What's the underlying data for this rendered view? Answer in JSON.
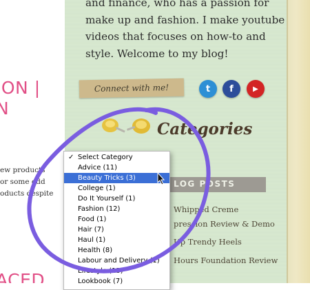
{
  "left_column": {
    "title_lines": [
      "ION |",
      "N"
    ],
    "snippet_lines": [
      "ew products",
      "or some odd",
      "oducts despite"
    ],
    "bottom_title": "ACED"
  },
  "about": {
    "lines": [
      "and finance, who has a passion for",
      "make up and fashion. I make youtube",
      "videos that focuses on how-to and",
      "style. Welcome to my blog!"
    ]
  },
  "connect": {
    "label": "Connect with me!"
  },
  "social": [
    {
      "icon": "twitter-icon",
      "glyph": "t",
      "color": "#2d8fd5"
    },
    {
      "icon": "facebook-icon",
      "glyph": "f",
      "color": "#2d4d9a"
    },
    {
      "icon": "youtube-icon",
      "glyph": "▶",
      "color": "#d32525"
    }
  ],
  "categories": {
    "title": "Categories",
    "options": [
      {
        "label": "Select Category",
        "checked": true
      },
      {
        "label": "Advice  (11)"
      },
      {
        "label": "Beauty Tricks  (3)",
        "selected": true
      },
      {
        "label": "College  (1)"
      },
      {
        "label": "Do It Yourself  (1)"
      },
      {
        "label": "Fashion  (12)"
      },
      {
        "label": "Food  (1)"
      },
      {
        "label": "Hair  (7)"
      },
      {
        "label": "Haul  (1)"
      },
      {
        "label": "Health  (8)"
      },
      {
        "label": "Labour and Delivery  (1)"
      },
      {
        "label": "Lifestyle  (15)"
      },
      {
        "label": "Lookbook  (7)"
      }
    ]
  },
  "recent_posts": {
    "header": "LOG POSTS",
    "items": [
      "Whipped Creme",
      "pression Review & Demo",
      "Up Trendy Heels",
      "Hours Foundation Review"
    ]
  },
  "colors": {
    "accent_pink": "#e14f86",
    "selection_blue": "#3b6fd6",
    "annotation_purple": "#7a5de0"
  }
}
